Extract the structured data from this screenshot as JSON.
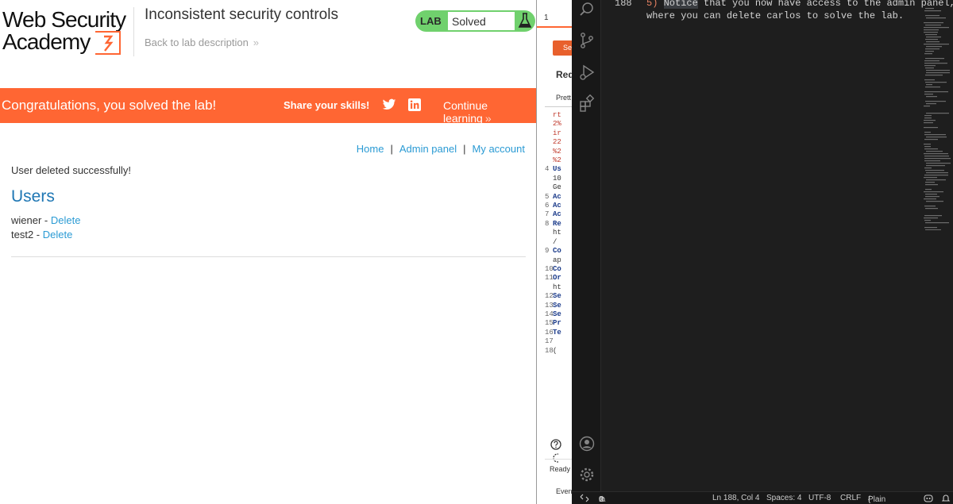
{
  "lab": {
    "logo_line1": "Web Security",
    "logo_line2": "Academy",
    "title": "Inconsistent security controls",
    "back_link": "Back to lab description",
    "status_tag": "LAB",
    "status_value": "Solved",
    "banner": {
      "message": "Congratulations, you solved the lab!",
      "share": "Share your skills!",
      "continue": "Continue learning"
    },
    "nav": {
      "home": "Home",
      "sep": "|",
      "admin": "Admin panel",
      "account": "My account"
    },
    "notice": "User deleted successfully!",
    "users_heading": "Users",
    "users": [
      {
        "name": "wiener",
        "sep": " - ",
        "action": "Delete"
      },
      {
        "name": "test2",
        "sep": " - ",
        "action": "Delete"
      }
    ]
  },
  "burp": {
    "tab_number": "1",
    "send_label": "Se",
    "request_label": "Req",
    "pretty_label": "Prett",
    "code_lines": [
      {
        "n": "",
        "t": "rt",
        "c": "rd"
      },
      {
        "n": "",
        "t": "2%",
        "c": "rd"
      },
      {
        "n": "",
        "t": "ir",
        "c": "rd"
      },
      {
        "n": "",
        "t": "22",
        "c": "rd"
      },
      {
        "n": "",
        "t": "%2",
        "c": "rd"
      },
      {
        "n": "",
        "t": "%2",
        "c": "rd"
      },
      {
        "n": "4",
        "t": "Us",
        "c": "kw"
      },
      {
        "n": "",
        "t": "10",
        "c": "tx"
      },
      {
        "n": "",
        "t": "Ge",
        "c": "tx"
      },
      {
        "n": "5",
        "t": "Ac",
        "c": "kw"
      },
      {
        "n": "6",
        "t": "Ac",
        "c": "kw"
      },
      {
        "n": "7",
        "t": "Ac",
        "c": "kw"
      },
      {
        "n": "8",
        "t": "Re",
        "c": "kw"
      },
      {
        "n": "",
        "t": "ht",
        "c": "tx"
      },
      {
        "n": "",
        "t": "/",
        "c": "tx"
      },
      {
        "n": "9",
        "t": "Co",
        "c": "kw"
      },
      {
        "n": "",
        "t": "ap",
        "c": "tx"
      },
      {
        "n": "10",
        "t": "Co",
        "c": "kw"
      },
      {
        "n": "11",
        "t": "Or",
        "c": "kw"
      },
      {
        "n": "",
        "t": "ht",
        "c": "tx"
      },
      {
        "n": "12",
        "t": "Se",
        "c": "kw"
      },
      {
        "n": "13",
        "t": "Se",
        "c": "kw"
      },
      {
        "n": "14",
        "t": "Se",
        "c": "kw"
      },
      {
        "n": "15",
        "t": "Pr",
        "c": "kw"
      },
      {
        "n": "16",
        "t": "Te",
        "c": "kw"
      },
      {
        "n": "17",
        "t": "",
        "c": "tx"
      },
      {
        "n": "18",
        "t": "(",
        "c": "tx"
      }
    ],
    "ready": "Ready",
    "events": "Even"
  },
  "vscode": {
    "line_number": "188",
    "line_prefix": "5)",
    "highlight_word": "Notice",
    "line1_rest": " that you now have access to the admin panel,",
    "line2": "where you can delete carlos to solve the lab.",
    "status": {
      "errors": "0",
      "warnings": "0",
      "position": "Ln 188, Col 4",
      "spaces": "Spaces: 4",
      "encoding": "UTF-8",
      "eol": "CRLF",
      "language": "Plain Text"
    }
  },
  "colors": {
    "brand_orange": "#ff6633",
    "solved_green": "#70d16d",
    "link_blue": "#2b9bd4"
  }
}
